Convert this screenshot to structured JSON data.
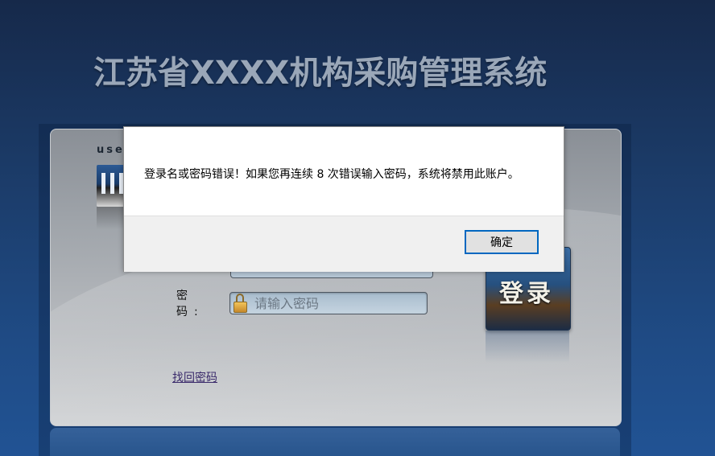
{
  "header": {
    "title": "江苏省XXXX机构采购管理系统"
  },
  "login_panel": {
    "user_label": "use",
    "password_label": "密  码:",
    "password_placeholder": "请输入密码",
    "login_button": "登录",
    "forgot_password": "找回密码"
  },
  "dialog": {
    "message": "登录名或密码错误！如果您再连续 8 次错误输入密码，系统将禁用此账户。",
    "ok_button": "确定"
  },
  "colors": {
    "background_top": "#16294a",
    "background_bottom": "#215394",
    "dialog_accent": "#0067c0"
  }
}
